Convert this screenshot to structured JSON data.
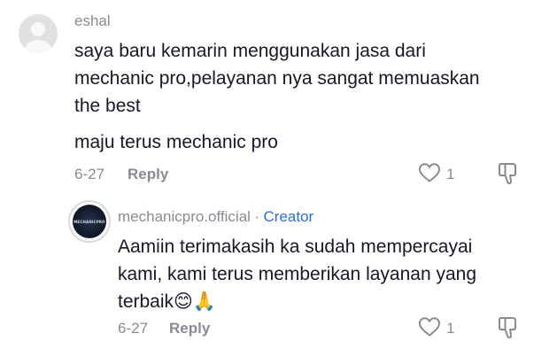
{
  "comment": {
    "username": "eshal",
    "lines": [
      "saya baru kemarin menggunakan jasa dari",
      "mechanic pro,pelayanan nya sangat memuaskan",
      "the best"
    ],
    "line2": "maju terus mechanic pro",
    "date": "6-27",
    "reply_label": "Reply",
    "likes": "1"
  },
  "reply": {
    "username": "mechanicpro.official",
    "separator": "·",
    "tag": "Creator",
    "avatar_text": "MECHANICPRO",
    "lines": [
      "Aamiin terimakasih ka sudah mempercayai",
      "kami, kami terus memberikan layanan yang",
      "terbaik"
    ],
    "emojis": "😊🙏",
    "date": "6-27",
    "reply_label": "Reply",
    "likes": "1"
  },
  "colors": {
    "text": "#161823",
    "secondary": "#8a8b91",
    "creator": "#2b6fd6"
  },
  "icons": [
    "default-avatar-icon",
    "heart-icon",
    "dislike-icon"
  ]
}
